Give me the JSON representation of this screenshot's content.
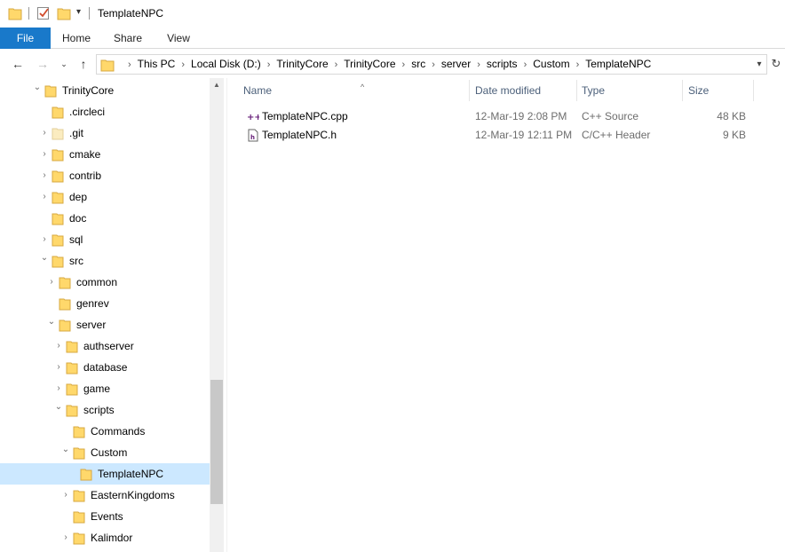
{
  "window": {
    "title": "TemplateNPC"
  },
  "ribbon": {
    "tabs": [
      {
        "label": "File"
      },
      {
        "label": "Home"
      },
      {
        "label": "Share"
      },
      {
        "label": "View"
      }
    ]
  },
  "address": {
    "crumbs": [
      "This PC",
      "Local Disk (D:)",
      "TrinityCore",
      "TrinityCore",
      "src",
      "server",
      "scripts",
      "Custom",
      "TemplateNPC"
    ]
  },
  "nav_tree": [
    {
      "label": "TrinityCore",
      "arrow": "expanded",
      "level": 0
    },
    {
      "label": ".circleci",
      "arrow": "none",
      "level": 1
    },
    {
      "label": ".git",
      "arrow": "collapsed",
      "level": 1,
      "faded": true
    },
    {
      "label": "cmake",
      "arrow": "collapsed",
      "level": 1
    },
    {
      "label": "contrib",
      "arrow": "collapsed",
      "level": 1
    },
    {
      "label": "dep",
      "arrow": "collapsed",
      "level": 1
    },
    {
      "label": "doc",
      "arrow": "none",
      "level": 1
    },
    {
      "label": "sql",
      "arrow": "collapsed",
      "level": 1
    },
    {
      "label": "src",
      "arrow": "expanded",
      "level": 1
    },
    {
      "label": "common",
      "arrow": "collapsed",
      "level": 2
    },
    {
      "label": "genrev",
      "arrow": "none",
      "level": 2
    },
    {
      "label": "server",
      "arrow": "expanded",
      "level": 2
    },
    {
      "label": "authserver",
      "arrow": "collapsed",
      "level": 3
    },
    {
      "label": "database",
      "arrow": "collapsed",
      "level": 3
    },
    {
      "label": "game",
      "arrow": "collapsed",
      "level": 3
    },
    {
      "label": "scripts",
      "arrow": "expanded",
      "level": 3
    },
    {
      "label": "Commands",
      "arrow": "none",
      "level": 4
    },
    {
      "label": "Custom",
      "arrow": "expanded",
      "level": 4
    },
    {
      "label": "TemplateNPC",
      "arrow": "none",
      "level": 5,
      "selected": true
    },
    {
      "label": "EasternKingdoms",
      "arrow": "collapsed",
      "level": 4
    },
    {
      "label": "Events",
      "arrow": "none",
      "level": 4
    },
    {
      "label": "Kalimdor",
      "arrow": "collapsed",
      "level": 4
    }
  ],
  "columns": {
    "name": "Name",
    "date": "Date modified",
    "type": "Type",
    "size": "Size"
  },
  "files": [
    {
      "name": "TemplateNPC.cpp",
      "date": "12-Mar-19 2:08 PM",
      "type": "C++ Source",
      "size": "48 KB",
      "icon": "cpp-file-icon"
    },
    {
      "name": "TemplateNPC.h",
      "date": "12-Mar-19 12:11 PM",
      "type": "C/C++ Header",
      "size": "9 KB",
      "icon": "header-file-icon"
    }
  ],
  "colors": {
    "file_tab": "#1979ca",
    "selection": "#cce8ff",
    "folder": "#ffd86b",
    "header_text": "#4c607a"
  }
}
